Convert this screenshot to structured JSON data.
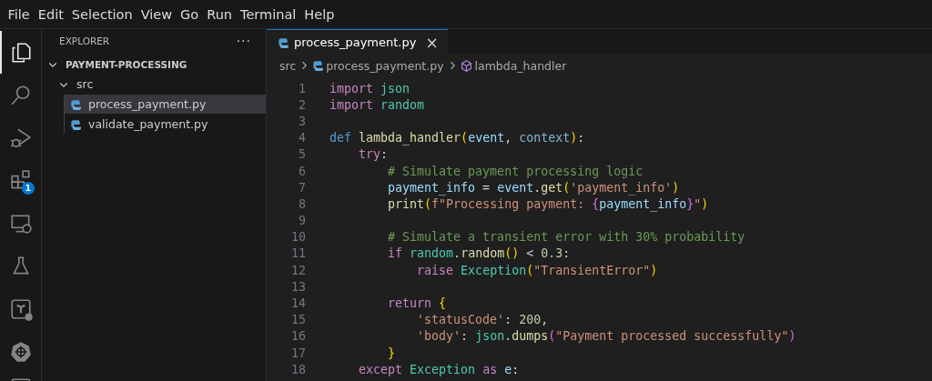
{
  "menu": [
    "File",
    "Edit",
    "Selection",
    "View",
    "Go",
    "Run",
    "Terminal",
    "Help"
  ],
  "activity_bar": [
    {
      "kind": "files",
      "selected": true
    },
    {
      "kind": "search",
      "selected": false
    },
    {
      "kind": "debug",
      "selected": false
    },
    {
      "kind": "extensions",
      "selected": false,
      "badge": "1"
    },
    {
      "kind": "remote",
      "selected": false
    },
    {
      "kind": "testing",
      "selected": false
    },
    {
      "kind": "terraform",
      "selected": false
    },
    {
      "kind": "kubernetes",
      "selected": false
    },
    {
      "kind": "partial",
      "selected": false
    }
  ],
  "sidebar": {
    "title": "EXPLORER",
    "more": "···",
    "tree": [
      {
        "label": "PAYMENT-PROCESSING",
        "kind": "root",
        "expanded": true,
        "children": [
          {
            "label": "src",
            "kind": "folder",
            "expanded": true,
            "children": [
              {
                "label": "process_payment.py",
                "kind": "python",
                "selected": true
              },
              {
                "label": "validate_payment.py",
                "kind": "python",
                "selected": false
              }
            ]
          }
        ]
      }
    ]
  },
  "tabs": [
    {
      "label": "process_payment.py",
      "selected": true,
      "close": "×"
    }
  ],
  "breadcrumbs": [
    {
      "label": "src",
      "kind": "folder"
    },
    {
      "label": "process_payment.py",
      "kind": "python"
    },
    {
      "label": "lambda_handler",
      "kind": "method"
    }
  ],
  "code": [
    {
      "number": "1",
      "tokens": [
        {
          "text": "import ",
          "kind": "kw"
        },
        {
          "text": "json",
          "kind": "mod"
        }
      ]
    },
    {
      "number": "2",
      "tokens": [
        {
          "text": "import ",
          "kind": "kw"
        },
        {
          "text": "random",
          "kind": "mod"
        }
      ]
    },
    {
      "number": "3"
    },
    {
      "number": "4",
      "tokens": [
        {
          "text": "def ",
          "kind": "def"
        },
        {
          "text": "lambda_handler",
          "kind": "fn"
        },
        {
          "text": "(",
          "kind": "b1"
        },
        {
          "text": "event",
          "kind": "var"
        },
        {
          "text": ", ",
          "kind": "p"
        },
        {
          "text": "context",
          "kind": "param"
        },
        {
          "text": ")",
          "kind": "b1"
        },
        {
          "text": ":",
          "kind": "p"
        }
      ]
    },
    {
      "number": "5",
      "tokens": [
        {
          "text": "    try",
          "kind": "kw"
        },
        {
          "text": ":",
          "kind": "p"
        }
      ]
    },
    {
      "number": "6",
      "tokens": [
        {
          "text": "        # Simulate payment processing logic",
          "kind": "cm"
        }
      ]
    },
    {
      "number": "7",
      "tokens": [
        {
          "text": "        payment_info",
          "kind": "var"
        },
        {
          "text": " = ",
          "kind": "p"
        },
        {
          "text": "event",
          "kind": "var"
        },
        {
          "text": ".",
          "kind": "p"
        },
        {
          "text": "get",
          "kind": "fn"
        },
        {
          "text": "(",
          "kind": "b1"
        },
        {
          "text": "'payment_info'",
          "kind": "str"
        },
        {
          "text": ")",
          "kind": "b1"
        }
      ]
    },
    {
      "number": "8",
      "tokens": [
        {
          "text": "        print",
          "kind": "fn"
        },
        {
          "text": "(",
          "kind": "b1"
        },
        {
          "text": "f\"Processing payment: ",
          "kind": "str"
        },
        {
          "text": "{",
          "kind": "b2"
        },
        {
          "text": "payment_info",
          "kind": "var"
        },
        {
          "text": "}",
          "kind": "b2"
        },
        {
          "text": "\"",
          "kind": "str"
        },
        {
          "text": ")",
          "kind": "b1"
        }
      ]
    },
    {
      "number": "9"
    },
    {
      "number": "10",
      "tokens": [
        {
          "text": "        # Simulate a transient error with 30% probability",
          "kind": "cm"
        }
      ]
    },
    {
      "number": "11",
      "tokens": [
        {
          "text": "        if ",
          "kind": "kw"
        },
        {
          "text": "random",
          "kind": "mod"
        },
        {
          "text": ".",
          "kind": "p"
        },
        {
          "text": "random",
          "kind": "fn"
        },
        {
          "text": "()",
          "kind": "b1"
        },
        {
          "text": " < ",
          "kind": "p"
        },
        {
          "text": "0.3",
          "kind": "num"
        },
        {
          "text": ":",
          "kind": "p"
        }
      ]
    },
    {
      "number": "12",
      "tokens": [
        {
          "text": "            raise ",
          "kind": "kw"
        },
        {
          "text": "Exception",
          "kind": "mod"
        },
        {
          "text": "(",
          "kind": "b1"
        },
        {
          "text": "\"TransientError\"",
          "kind": "str"
        },
        {
          "text": ")",
          "kind": "b1"
        }
      ]
    },
    {
      "number": "13"
    },
    {
      "number": "14",
      "tokens": [
        {
          "text": "        return ",
          "kind": "kw"
        },
        {
          "text": "{",
          "kind": "b1"
        }
      ]
    },
    {
      "number": "15",
      "tokens": [
        {
          "text": "            'statusCode'",
          "kind": "str"
        },
        {
          "text": ": ",
          "kind": "p"
        },
        {
          "text": "200",
          "kind": "num"
        },
        {
          "text": ",",
          "kind": "p"
        }
      ]
    },
    {
      "number": "16",
      "tokens": [
        {
          "text": "            'body'",
          "kind": "str"
        },
        {
          "text": ": ",
          "kind": "p"
        },
        {
          "text": "json",
          "kind": "mod"
        },
        {
          "text": ".",
          "kind": "p"
        },
        {
          "text": "dumps",
          "kind": "fn"
        },
        {
          "text": "(",
          "kind": "b2"
        },
        {
          "text": "\"Payment processed successfully\"",
          "kind": "str"
        },
        {
          "text": ")",
          "kind": "b2"
        }
      ]
    },
    {
      "number": "17",
      "tokens": [
        {
          "text": "        }",
          "kind": "b1"
        }
      ]
    },
    {
      "number": "18",
      "tokens": [
        {
          "text": "    except ",
          "kind": "kw"
        },
        {
          "text": "Exception ",
          "kind": "mod"
        },
        {
          "text": "as ",
          "kind": "kw"
        },
        {
          "text": "e",
          "kind": "var"
        },
        {
          "text": ":",
          "kind": "p"
        }
      ]
    }
  ]
}
